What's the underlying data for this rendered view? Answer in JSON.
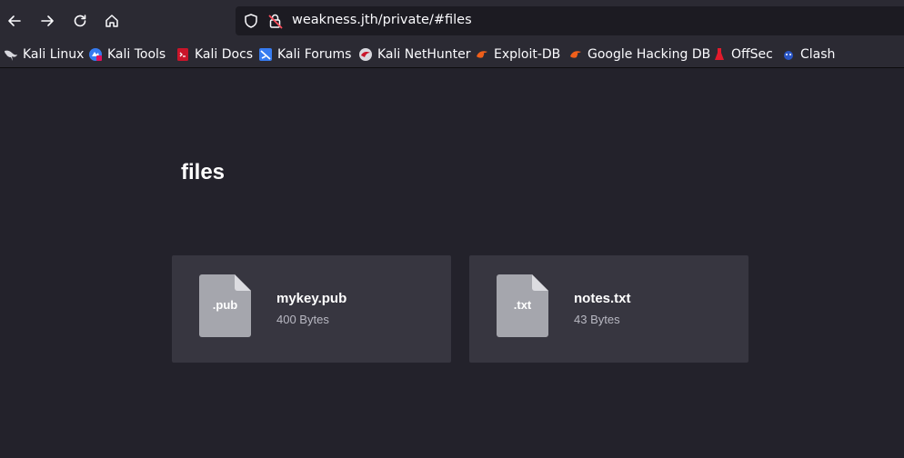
{
  "browser": {
    "url": "weakness.jth/private/#files"
  },
  "bookmarks": [
    {
      "label": "Kali Linux",
      "icon": "kali-dragon-icon"
    },
    {
      "label": "Kali Tools",
      "icon": "kali-tools-icon"
    },
    {
      "label": "Kali Docs",
      "icon": "kali-docs-icon"
    },
    {
      "label": "Kali Forums",
      "icon": "kali-forums-icon"
    },
    {
      "label": "Kali NetHunter",
      "icon": "kali-nethunter-icon"
    },
    {
      "label": "Exploit-DB",
      "icon": "exploit-db-icon"
    },
    {
      "label": "Google Hacking DB",
      "icon": "ghdb-icon"
    },
    {
      "label": "OffSec",
      "icon": "offsec-icon"
    },
    {
      "label": "Clash",
      "icon": "clash-icon"
    }
  ],
  "page": {
    "title": "files",
    "files": [
      {
        "ext": ".pub",
        "name": "mykey.pub",
        "size": "400 Bytes"
      },
      {
        "ext": ".txt",
        "name": "notes.txt",
        "size": "43 Bytes"
      }
    ]
  },
  "colors": {
    "page_background": "#23222b",
    "toolbar": "#2b2a33",
    "card": "#373640",
    "file_icon": "#a5a6ad"
  }
}
